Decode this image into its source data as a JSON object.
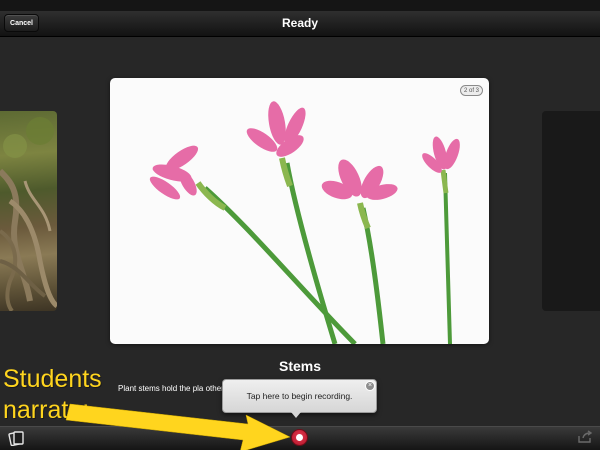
{
  "nav": {
    "cancel_label": "Cancel",
    "title": "Ready"
  },
  "slide": {
    "counter": "2 of 3",
    "title": "Stems",
    "caption": "Plant stems hold the pla                                             other parts of the plant.",
    "flower_color": "#e66ca7",
    "stem_color": "#4d9a3a"
  },
  "tooltip": {
    "text": "Tap here to begin recording."
  },
  "annotation": {
    "line1": "Students",
    "line2": "narrate:",
    "color": "#ffd51e"
  },
  "toolbar": {
    "left_icon": "cards-icon",
    "center_icon": "record-icon",
    "right_icon": "share-icon",
    "record_color": "#d3213a"
  }
}
